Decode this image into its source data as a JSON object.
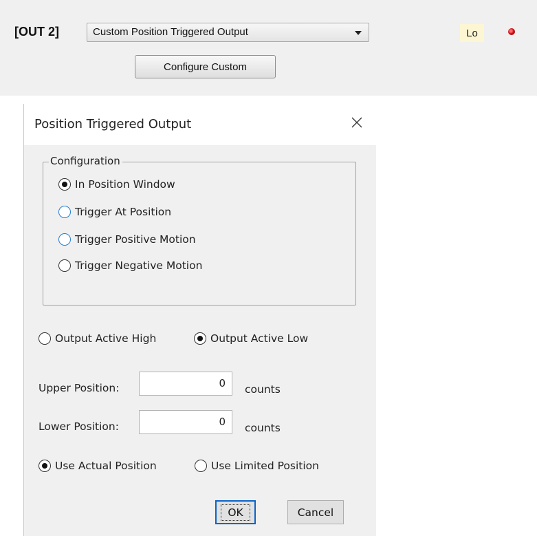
{
  "output": {
    "label": "[OUT 2]",
    "mode_select": {
      "value": "Custom Position Triggered Output"
    },
    "configure_button": "Configure Custom",
    "state_badge": "Lo",
    "led_color": "#d0101a"
  },
  "dialog": {
    "title": "Position Triggered Output",
    "configuration": {
      "legend": "Configuration",
      "options": [
        {
          "label": "In Position Window",
          "checked": true
        },
        {
          "label": "Trigger At Position",
          "checked": false
        },
        {
          "label": "Trigger Positive Motion",
          "checked": false
        },
        {
          "label": "Trigger Negative Motion",
          "checked": false
        }
      ]
    },
    "polarity": {
      "high_label": "Output Active High",
      "low_label": "Output Active Low",
      "selected": "low"
    },
    "upper_position": {
      "label": "Upper Position:",
      "value": "0",
      "unit": "counts"
    },
    "lower_position": {
      "label": "Lower Position:",
      "value": "0",
      "unit": "counts"
    },
    "position_source": {
      "actual_label": "Use Actual Position",
      "limited_label": "Use Limited Position",
      "selected": "actual"
    },
    "ok_label": "OK",
    "cancel_label": "Cancel"
  }
}
